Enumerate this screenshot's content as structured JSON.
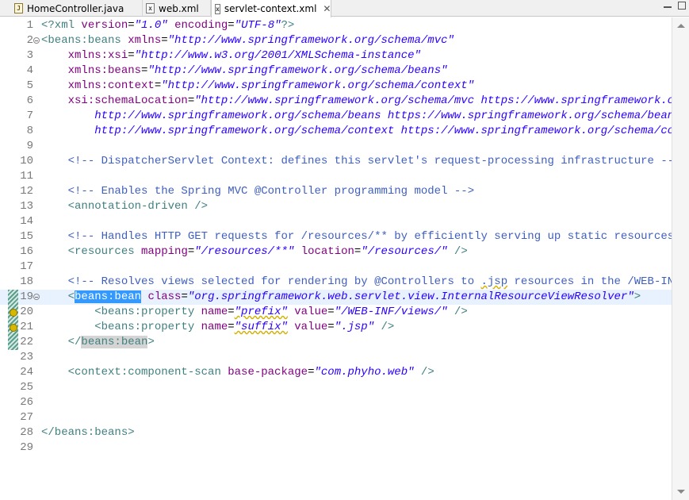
{
  "tabs": [
    {
      "label": "HomeController.java",
      "icon": "java-file-icon"
    },
    {
      "label": "web.xml",
      "icon": "xml-file-icon"
    },
    {
      "label": "servlet-context.xml",
      "icon": "xml-file-icon",
      "active": true
    }
  ],
  "tab_close_glyph": "✕",
  "icon_glyphs": {
    "java": "J",
    "xml": "x"
  },
  "lines": [
    {
      "n": "1",
      "tokens": [
        {
          "c": "tg",
          "t": "<?xml "
        },
        {
          "c": "at",
          "t": "version"
        },
        {
          "c": "",
          "t": "="
        },
        {
          "c": "av",
          "t": "\"1.0\""
        },
        {
          "c": "",
          "t": " "
        },
        {
          "c": "at",
          "t": "encoding"
        },
        {
          "c": "",
          "t": "="
        },
        {
          "c": "av",
          "t": "\"UTF-8\""
        },
        {
          "c": "tg",
          "t": "?>"
        }
      ]
    },
    {
      "n": "2",
      "fold": true,
      "tokens": [
        {
          "c": "tg",
          "t": "<beans:beans "
        },
        {
          "c": "at",
          "t": "xmlns"
        },
        {
          "c": "",
          "t": "="
        },
        {
          "c": "av",
          "t": "\"http://www.springframework.org/schema/mvc\""
        }
      ]
    },
    {
      "n": "3",
      "tokens": [
        {
          "c": "",
          "t": "    "
        },
        {
          "c": "at",
          "t": "xmlns:xsi"
        },
        {
          "c": "",
          "t": "="
        },
        {
          "c": "av",
          "t": "\"http://www.w3.org/2001/XMLSchema-instance\""
        }
      ]
    },
    {
      "n": "4",
      "tokens": [
        {
          "c": "",
          "t": "    "
        },
        {
          "c": "at",
          "t": "xmlns:beans"
        },
        {
          "c": "",
          "t": "="
        },
        {
          "c": "av",
          "t": "\"http://www.springframework.org/schema/beans\""
        }
      ]
    },
    {
      "n": "5",
      "tokens": [
        {
          "c": "",
          "t": "    "
        },
        {
          "c": "at",
          "t": "xmlns:context"
        },
        {
          "c": "",
          "t": "="
        },
        {
          "c": "av",
          "t": "\"http://www.springframework.org/schema/context\""
        }
      ]
    },
    {
      "n": "6",
      "tokens": [
        {
          "c": "",
          "t": "    "
        },
        {
          "c": "at",
          "t": "xsi:schemaLocation"
        },
        {
          "c": "",
          "t": "="
        },
        {
          "c": "av",
          "t": "\"http://www.springframework.org/schema/mvc https://www.springframework.org/s"
        }
      ]
    },
    {
      "n": "7",
      "tokens": [
        {
          "c": "",
          "t": "        "
        },
        {
          "c": "av",
          "t": "http://www.springframework.org/schema/beans https://www.springframework.org/schema/beans/sp"
        }
      ]
    },
    {
      "n": "8",
      "tokens": [
        {
          "c": "",
          "t": "        "
        },
        {
          "c": "av",
          "t": "http://www.springframework.org/schema/context https://www.springframework.org/schema/contex"
        }
      ]
    },
    {
      "n": "9",
      "tokens": []
    },
    {
      "n": "10",
      "tokens": [
        {
          "c": "",
          "t": "    "
        },
        {
          "c": "cm",
          "t": "<!-- DispatcherServlet Context: defines this servlet's request-processing infrastructure -->"
        }
      ]
    },
    {
      "n": "11",
      "tokens": []
    },
    {
      "n": "12",
      "tokens": [
        {
          "c": "",
          "t": "    "
        },
        {
          "c": "cm",
          "t": "<!-- Enables the Spring MVC @Controller programming model -->"
        }
      ]
    },
    {
      "n": "13",
      "tokens": [
        {
          "c": "",
          "t": "    "
        },
        {
          "c": "tg",
          "t": "<annotation-driven />"
        }
      ]
    },
    {
      "n": "14",
      "tokens": []
    },
    {
      "n": "15",
      "tokens": [
        {
          "c": "",
          "t": "    "
        },
        {
          "c": "cm",
          "t": "<!-- Handles HTTP GET requests for /resources/** by efficiently serving up static resources in"
        }
      ]
    },
    {
      "n": "16",
      "tokens": [
        {
          "c": "",
          "t": "    "
        },
        {
          "c": "tg",
          "t": "<resources "
        },
        {
          "c": "at",
          "t": "mapping"
        },
        {
          "c": "",
          "t": "="
        },
        {
          "c": "av",
          "t": "\"/resources/**\""
        },
        {
          "c": "",
          "t": " "
        },
        {
          "c": "at",
          "t": "location"
        },
        {
          "c": "",
          "t": "="
        },
        {
          "c": "av",
          "t": "\"/resources/\""
        },
        {
          "c": "tg",
          "t": " />"
        }
      ]
    },
    {
      "n": "17",
      "tokens": []
    },
    {
      "n": "18",
      "tokens": [
        {
          "c": "",
          "t": "    "
        },
        {
          "c": "cm",
          "t": "<!-- Resolves views selected for rendering by @Controllers to "
        },
        {
          "c": "cm sq",
          "t": ".jsp"
        },
        {
          "c": "cm",
          "t": " resources in the /WEB-INF/vi"
        }
      ]
    },
    {
      "n": "19",
      "fold": true,
      "current": true,
      "tokens": [
        {
          "c": "",
          "t": "    "
        },
        {
          "c": "tg",
          "t": "<"
        },
        {
          "c": "tg sel",
          "t": "beans:bean"
        },
        {
          "c": "tg",
          "t": " "
        },
        {
          "c": "at",
          "t": "class"
        },
        {
          "c": "",
          "t": "="
        },
        {
          "c": "av",
          "t": "\"org.springframework.web.servlet.view.InternalResourceViewResolver\""
        },
        {
          "c": "tg",
          "t": ">"
        }
      ]
    },
    {
      "n": "20",
      "tokens": [
        {
          "c": "",
          "t": "        "
        },
        {
          "c": "tg",
          "t": "<beans:property "
        },
        {
          "c": "at",
          "t": "name"
        },
        {
          "c": "",
          "t": "="
        },
        {
          "c": "av sq",
          "t": "\"prefix\""
        },
        {
          "c": "",
          "t": " "
        },
        {
          "c": "at",
          "t": "value"
        },
        {
          "c": "",
          "t": "="
        },
        {
          "c": "av",
          "t": "\"/WEB-INF/views/\""
        },
        {
          "c": "tg",
          "t": " />"
        }
      ]
    },
    {
      "n": "21",
      "tokens": [
        {
          "c": "",
          "t": "        "
        },
        {
          "c": "tg",
          "t": "<beans:property "
        },
        {
          "c": "at",
          "t": "name"
        },
        {
          "c": "",
          "t": "="
        },
        {
          "c": "av sq",
          "t": "\"suffix\""
        },
        {
          "c": "",
          "t": " "
        },
        {
          "c": "at",
          "t": "value"
        },
        {
          "c": "",
          "t": "="
        },
        {
          "c": "av",
          "t": "\".jsp\""
        },
        {
          "c": "tg",
          "t": " />"
        }
      ]
    },
    {
      "n": "22",
      "tokens": [
        {
          "c": "",
          "t": "    "
        },
        {
          "c": "tg",
          "t": "</"
        },
        {
          "c": "tg hl",
          "t": "beans:bean"
        },
        {
          "c": "tg",
          "t": ">"
        }
      ]
    },
    {
      "n": "23",
      "tokens": []
    },
    {
      "n": "24",
      "tokens": [
        {
          "c": "",
          "t": "    "
        },
        {
          "c": "tg",
          "t": "<context:component-scan "
        },
        {
          "c": "at",
          "t": "base-package"
        },
        {
          "c": "",
          "t": "="
        },
        {
          "c": "av",
          "t": "\"com.phyho.web\""
        },
        {
          "c": "tg",
          "t": " />"
        }
      ]
    },
    {
      "n": "25",
      "tokens": []
    },
    {
      "n": "26",
      "tokens": []
    },
    {
      "n": "27",
      "tokens": []
    },
    {
      "n": "28",
      "tokens": [
        {
          "c": "tg",
          "t": "</beans:beans>"
        }
      ]
    },
    {
      "n": "29",
      "tokens": []
    }
  ]
}
